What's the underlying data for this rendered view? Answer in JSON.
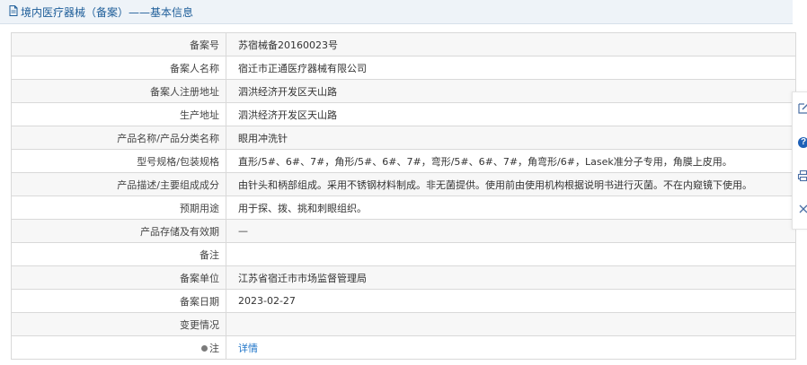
{
  "header": {
    "title": "境内医疗器械（备案）——基本信息"
  },
  "rows": [
    {
      "label": "备案号",
      "value": "苏宿械备20160023号"
    },
    {
      "label": "备案人名称",
      "value": "宿迁市正通医疗器械有限公司"
    },
    {
      "label": "备案人注册地址",
      "value": "泗洪经济开发区天山路"
    },
    {
      "label": "生产地址",
      "value": "泗洪经济开发区天山路"
    },
    {
      "label": "产品名称/产品分类名称",
      "value": "眼用冲洗针"
    },
    {
      "label": "型号规格/包装规格",
      "value": "直形/5#、6#、7#，角形/5#、6#、7#，弯形/5#、6#、7#，角弯形/6#，Lasek准分子专用，角膜上皮用。"
    },
    {
      "label": "产品描述/主要组成成分",
      "value": "由针头和柄部组成。采用不锈钢材料制成。非无菌提供。使用前由使用机构根据说明书进行灭菌。不在内窥镜下使用。"
    },
    {
      "label": "预期用途",
      "value": "用于探、拨、挑和刺眼组织。"
    },
    {
      "label": "产品存储及有效期",
      "value": "—"
    },
    {
      "label": "备注",
      "value": ""
    },
    {
      "label": "备案单位",
      "value": "江苏省宿迁市市场监督管理局"
    },
    {
      "label": "备案日期",
      "value": "2023-02-27"
    },
    {
      "label": "变更情况",
      "value": ""
    },
    {
      "label": "注",
      "value": "详情"
    }
  ],
  "sidebar": {
    "icons": [
      "edit-icon",
      "help-icon",
      "print-icon",
      "close-icon"
    ]
  },
  "colors": {
    "header_bg": "#eef3f8",
    "title": "#1d5d99",
    "link": "#1e74c8",
    "row_alt": "#f7f7f7",
    "border": "#d9d9d9"
  }
}
